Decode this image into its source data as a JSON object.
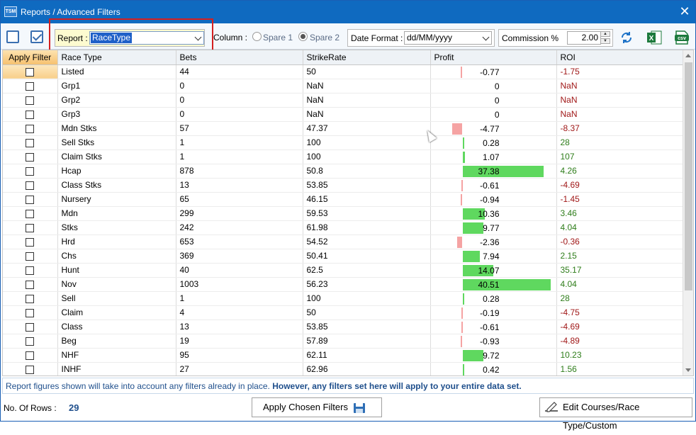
{
  "window": {
    "logo": "TSM",
    "title": "Reports / Advanced Filters",
    "close": "✕"
  },
  "toolbar": {
    "report_label": "Report :",
    "report_value": "RaceType",
    "column_label": "Column :",
    "spare1": "Spare 1",
    "spare2": "Spare 2",
    "date_format_label": "Date Format :",
    "date_format_value": "dd/MM/yyyy",
    "commission_label": "Commission %",
    "commission_value": "2.00"
  },
  "grid": {
    "headers": [
      "Apply Filter",
      "Race Type",
      "Bets",
      "StrikeRate",
      "Profit",
      "ROI"
    ],
    "rows": [
      {
        "type": "Listed",
        "bets": "44",
        "strike": "50",
        "profit": "-0.77",
        "roi": "-1.75"
      },
      {
        "type": "Grp1",
        "bets": "0",
        "strike": "NaN",
        "profit": "0",
        "roi": "NaN"
      },
      {
        "type": "Grp2",
        "bets": "0",
        "strike": "NaN",
        "profit": "0",
        "roi": "NaN"
      },
      {
        "type": "Grp3",
        "bets": "0",
        "strike": "NaN",
        "profit": "0",
        "roi": "NaN"
      },
      {
        "type": "Mdn Stks",
        "bets": "57",
        "strike": "47.37",
        "profit": "-4.77",
        "roi": "-8.37"
      },
      {
        "type": "Sell Stks",
        "bets": "1",
        "strike": "100",
        "profit": "0.28",
        "roi": "28"
      },
      {
        "type": "Claim Stks",
        "bets": "1",
        "strike": "100",
        "profit": "1.07",
        "roi": "107"
      },
      {
        "type": "Hcap",
        "bets": "878",
        "strike": "50.8",
        "profit": "37.38",
        "roi": "4.26"
      },
      {
        "type": "Class Stks",
        "bets": "13",
        "strike": "53.85",
        "profit": "-0.61",
        "roi": "-4.69"
      },
      {
        "type": "Nursery",
        "bets": "65",
        "strike": "46.15",
        "profit": "-0.94",
        "roi": "-1.45"
      },
      {
        "type": "Mdn",
        "bets": "299",
        "strike": "59.53",
        "profit": "10.36",
        "roi": "3.46"
      },
      {
        "type": "Stks",
        "bets": "242",
        "strike": "61.98",
        "profit": "9.77",
        "roi": "4.04"
      },
      {
        "type": "Hrd",
        "bets": "653",
        "strike": "54.52",
        "profit": "-2.36",
        "roi": "-0.36"
      },
      {
        "type": "Chs",
        "bets": "369",
        "strike": "50.41",
        "profit": "7.94",
        "roi": "2.15"
      },
      {
        "type": "Hunt",
        "bets": "40",
        "strike": "62.5",
        "profit": "14.07",
        "roi": "35.17"
      },
      {
        "type": "Nov",
        "bets": "1003",
        "strike": "56.23",
        "profit": "40.51",
        "roi": "4.04"
      },
      {
        "type": "Sell",
        "bets": "1",
        "strike": "100",
        "profit": "0.28",
        "roi": "28"
      },
      {
        "type": "Claim",
        "bets": "4",
        "strike": "50",
        "profit": "-0.19",
        "roi": "-4.75"
      },
      {
        "type": "Class",
        "bets": "13",
        "strike": "53.85",
        "profit": "-0.61",
        "roi": "-4.69"
      },
      {
        "type": "Beg",
        "bets": "19",
        "strike": "57.89",
        "profit": "-0.93",
        "roi": "-4.89"
      },
      {
        "type": "NHF",
        "bets": "95",
        "strike": "62.11",
        "profit": "9.72",
        "roi": "10.23"
      },
      {
        "type": "INHF",
        "bets": "27",
        "strike": "62.96",
        "profit": "0.42",
        "roi": "1.56"
      }
    ]
  },
  "colors": {
    "positive_bar": "#5fd85f",
    "negative_bar": "#f5a3a3",
    "title_bar": "#0f6ac0"
  },
  "footer": {
    "note_plain": "Report figures shown will take into account any filters already in place. ",
    "note_bold": "However, any filters set here will apply to your entire data set.",
    "rows_label": "No. Of Rows :",
    "rows_value": "29",
    "apply_button": "Apply Chosen Filters",
    "edit_button": "Edit Courses/Race Type/Custom"
  },
  "icons": [
    "refresh-icon",
    "excel-icon",
    "csv-icon",
    "save-icon",
    "edit-icon"
  ]
}
